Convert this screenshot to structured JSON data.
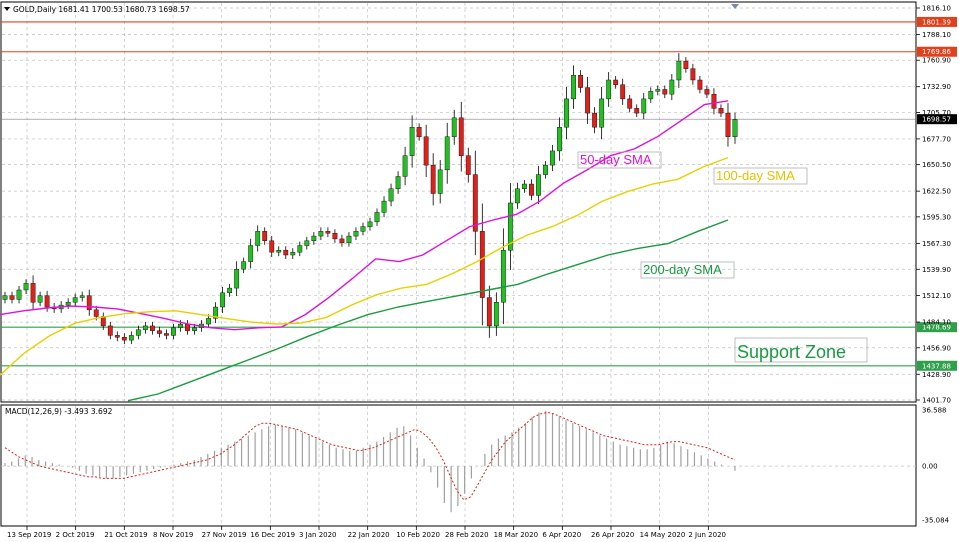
{
  "chart_data": [
    {
      "type": "candlestick",
      "header": "GOLD,Daily  1681.41 1700.53 1680.73 1698.57",
      "ylim": [
        1401.7,
        1816.1
      ],
      "y_ticks": [
        "1816.10",
        "1788.10",
        "1760.90",
        "1732.90",
        "1705.70",
        "1677.70",
        "1650.50",
        "1622.50",
        "1595.30",
        "1567.30",
        "1539.90",
        "1512.10",
        "1484.10",
        "1456.90",
        "1428.90",
        "1401.70"
      ],
      "x_tick_labels": [
        "13 Sep 2019",
        "2 Oct 2019",
        "21 Oct 2019",
        "8 Nov 2019",
        "27 Nov 2019",
        "16 Dec 2019",
        "3 Jan 2020",
        "22 Jan 2020",
        "10 Feb 2020",
        "28 Feb 2020",
        "18 Mar 2020",
        "6 Apr 2020",
        "26 Apr 2020",
        "14 May 2020",
        "2 Jun 2020"
      ],
      "current_price": "1698.57",
      "colors": {
        "up": "#22c022",
        "down": "#e0201a",
        "wick": "#000000",
        "grid": "#c0c0c0",
        "resistance": "#e0401a",
        "support": "#2fa04a",
        "sma50": "#e010e0",
        "sma100": "#e8d000",
        "sma200": "#1a9a40"
      },
      "horizontal_lines": [
        {
          "label": "1801.39",
          "value": 1801.39,
          "kind": "resistance"
        },
        {
          "label": "1769.86",
          "value": 1769.86,
          "kind": "resistance"
        },
        {
          "label": "1478.69",
          "value": 1478.69,
          "kind": "support"
        },
        {
          "label": "1437.88",
          "value": 1437.88,
          "kind": "support"
        }
      ],
      "series": [
        {
          "name": "50-day SMA",
          "values": [
            1492,
            1496,
            1499,
            1501,
            1500,
            1498,
            1493,
            1488,
            1482,
            1478,
            1476,
            1478,
            1479,
            1492,
            1510,
            1530,
            1551,
            1548,
            1555,
            1570,
            1585,
            1592,
            1598,
            1612,
            1631,
            1645,
            1660,
            1667,
            1680,
            1697,
            1714,
            1718
          ]
        },
        {
          "name": "100-day SMA",
          "values": [
            1428,
            1452,
            1470,
            1483,
            1489,
            1493,
            1495,
            1496,
            1492,
            1488,
            1484,
            1482,
            1483,
            1489,
            1502,
            1513,
            1520,
            1524,
            1535,
            1548,
            1563,
            1576,
            1585,
            1597,
            1612,
            1622,
            1630,
            1635,
            1648,
            1658
          ]
        },
        {
          "name": "200-day SMA",
          "values": [
            1401,
            1408,
            1420,
            1432,
            1444,
            1456,
            1469,
            1481,
            1492,
            1500,
            1506,
            1512,
            1518,
            1524,
            1535,
            1545,
            1555,
            1562,
            1567,
            1580,
            1592
          ]
        }
      ],
      "annotations": [
        {
          "text": "50-day SMA",
          "color": "#e010e0"
        },
        {
          "text": "100-day SMA",
          "color": "#e8c000"
        },
        {
          "text": "200-day SMA",
          "color": "#1a9a40"
        },
        {
          "text": "Support Zone",
          "color": "#1a9a40"
        }
      ],
      "close_points": [
        1512,
        1508,
        1518,
        1525,
        1505,
        1512,
        1500,
        1498,
        1502,
        1505,
        1510,
        1512,
        1497,
        1490,
        1480,
        1470,
        1468,
        1465,
        1470,
        1476,
        1480,
        1475,
        1472,
        1470,
        1478,
        1482,
        1475,
        1478,
        1482,
        1488,
        1500,
        1515,
        1520,
        1540,
        1548,
        1565,
        1580,
        1570,
        1558,
        1560,
        1555,
        1558,
        1565,
        1570,
        1575,
        1580,
        1578,
        1572,
        1568,
        1575,
        1580,
        1585,
        1590,
        1600,
        1612,
        1625,
        1638,
        1660,
        1690,
        1680,
        1650,
        1620,
        1645,
        1680,
        1700,
        1660,
        1640,
        1580,
        1510,
        1480,
        1505,
        1560,
        1610,
        1625,
        1630,
        1618,
        1640,
        1650,
        1665,
        1690,
        1720,
        1745,
        1732,
        1705,
        1690,
        1720,
        1740,
        1735,
        1720,
        1710,
        1705,
        1720,
        1728,
        1730,
        1725,
        1740,
        1760,
        1752,
        1740,
        1730,
        1725,
        1710,
        1705,
        1680,
        1698
      ]
    },
    {
      "type": "macd",
      "header": "MACD(12,26,9) -3.493 3.692",
      "ylim": [
        -35.084,
        36.588
      ],
      "y_ticks": [
        "36.588",
        "0.00",
        "-35.084"
      ],
      "colors": {
        "histogram": "#a0a0a0",
        "signal": "#e0201a"
      },
      "series": [
        {
          "name": "histogram",
          "values": [
            2,
            3,
            5,
            7,
            6,
            4,
            3,
            2,
            1,
            0,
            -1,
            -3,
            -5,
            -6,
            -7,
            -8,
            -8,
            -7,
            -6,
            -5,
            -4,
            -3,
            -2,
            -1,
            0,
            1,
            2,
            3,
            4,
            6,
            8,
            10,
            12,
            14,
            16,
            18,
            20,
            22,
            24,
            26,
            27,
            26,
            25,
            24,
            22,
            20,
            18,
            16,
            14,
            12,
            11,
            10,
            10,
            12,
            14,
            16,
            19,
            22,
            25,
            26,
            20,
            12,
            5,
            -4,
            -14,
            -24,
            -30,
            -26,
            -18,
            -8,
            0,
            8,
            14,
            18,
            20,
            22,
            25,
            28,
            32,
            35,
            36,
            34,
            32,
            30,
            28,
            26,
            24,
            22,
            20,
            18,
            16,
            14,
            13,
            12,
            11,
            11,
            12,
            14,
            16,
            15,
            13,
            11,
            9,
            7,
            5,
            3,
            1,
            0,
            -3
          ]
        },
        {
          "name": "signal",
          "values": [
            12,
            9,
            6,
            4,
            2,
            0,
            -1,
            -2,
            -3,
            -4,
            -5,
            -6,
            -7,
            -7,
            -8,
            -8,
            -8,
            -8,
            -7,
            -6,
            -5,
            -4,
            -3,
            -2,
            -1,
            0,
            1,
            2,
            3,
            4,
            6,
            8,
            11,
            14,
            18,
            22,
            26,
            28,
            28,
            27,
            26,
            25,
            24,
            22,
            20,
            18,
            16,
            14,
            13,
            12,
            11,
            10,
            11,
            12,
            14,
            16,
            18,
            20,
            22,
            24,
            22,
            18,
            12,
            4,
            -6,
            -16,
            -22,
            -20,
            -12,
            -4,
            4,
            10,
            16,
            20,
            24,
            28,
            32,
            34,
            35,
            34,
            32,
            30,
            28,
            26,
            24,
            22,
            20,
            19,
            18,
            17,
            16,
            15,
            14,
            14,
            14,
            15,
            16,
            16,
            15,
            14,
            13,
            12,
            10,
            8,
            6,
            4
          ]
        }
      ]
    }
  ]
}
